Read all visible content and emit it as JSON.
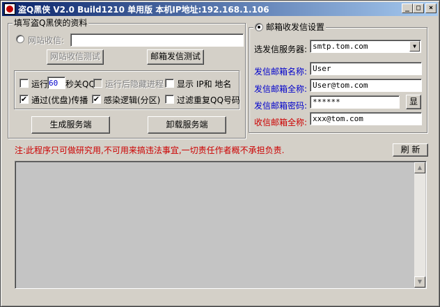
{
  "window": {
    "title": "盗Q黑侠 V2.0 Build1210 单用版 本机IP地址:192.168.1.106",
    "minimize": "_",
    "maximize": "□",
    "close": "×"
  },
  "left_group": {
    "legend": "填写盗Q黑侠的资料",
    "website_receive_label": "网站收信:",
    "website_receive_value": "",
    "website_test_button": "网站收信测试",
    "mail_test_button": "邮箱发信测试"
  },
  "options": {
    "run_label": "运行",
    "run_seconds": "60",
    "close_qq_label": "秒关QQ",
    "hide_process_label": "运行后隐藏进程",
    "show_ip_label": "显示 IP和 地名",
    "usb_spread_label": "通过(优盘)传播",
    "usb_spread_checked": "✔",
    "infect_logic_label": "感染逻辑(分区)",
    "infect_logic_checked": "✔",
    "filter_dup_label": "过滤重复QQ号码"
  },
  "buttons": {
    "generate_server": "生成服务端",
    "uninstall_server": "卸载服务端",
    "refresh": "刷 新"
  },
  "right_group": {
    "legend": "邮箱收发信设置",
    "smtp_label": "选发信服务器:",
    "smtp_value": "smtp.tom.com",
    "sender_name_label": "发信邮箱名称:",
    "sender_name_value": "User",
    "sender_full_label": "发信邮箱全称:",
    "sender_full_value": "User@tom.com",
    "sender_pass_label": "发信邮箱密码:",
    "sender_pass_value": "******",
    "show_button": "显",
    "receiver_label": "收信邮箱全称:",
    "receiver_value": "xxx@tom.com"
  },
  "notice": "注:此程序只可做研究用,不可用来搞违法事宜,一切责任作者概不承担负责.",
  "colors": {
    "titlebar_start": "#0a246a",
    "titlebar_end": "#a6caf0",
    "face": "#d4d0c8",
    "label_blue": "#0000cc",
    "label_red": "#cc0000"
  }
}
